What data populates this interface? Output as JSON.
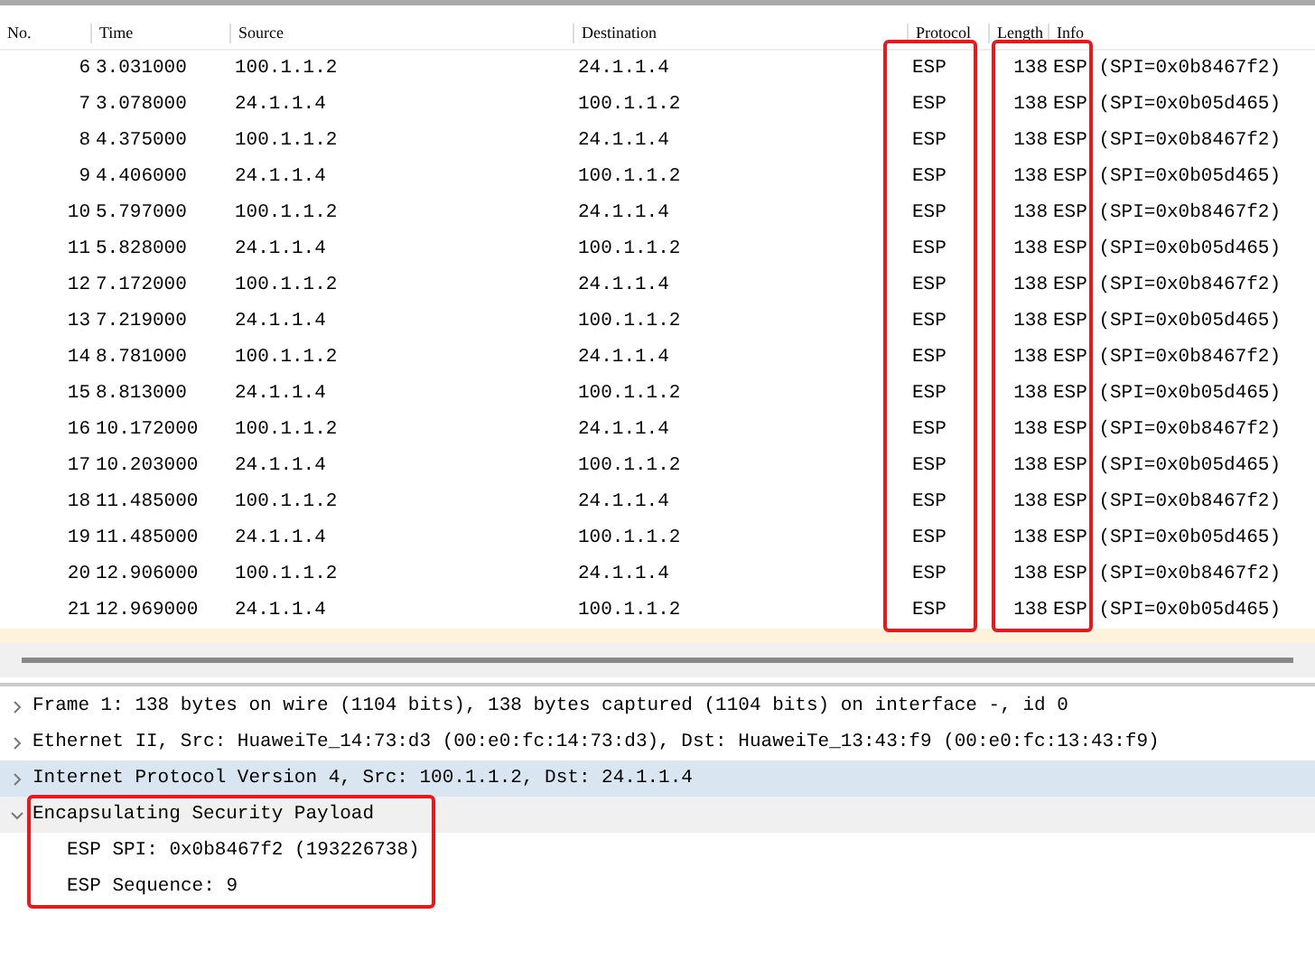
{
  "packet_list": {
    "columns": [
      "No.",
      "Time",
      "Source",
      "Destination",
      "Protocol",
      "Length",
      "Info"
    ],
    "rows": [
      [
        "6",
        "3.031000",
        "100.1.1.2",
        "24.1.1.4",
        "ESP",
        "138",
        "ESP (SPI=0x0b8467f2)"
      ],
      [
        "7",
        "3.078000",
        "24.1.1.4",
        "100.1.1.2",
        "ESP",
        "138",
        "ESP (SPI=0x0b05d465)"
      ],
      [
        "8",
        "4.375000",
        "100.1.1.2",
        "24.1.1.4",
        "ESP",
        "138",
        "ESP (SPI=0x0b8467f2)"
      ],
      [
        "9",
        "4.406000",
        "24.1.1.4",
        "100.1.1.2",
        "ESP",
        "138",
        "ESP (SPI=0x0b05d465)"
      ],
      [
        "10",
        "5.797000",
        "100.1.1.2",
        "24.1.1.4",
        "ESP",
        "138",
        "ESP (SPI=0x0b8467f2)"
      ],
      [
        "11",
        "5.828000",
        "24.1.1.4",
        "100.1.1.2",
        "ESP",
        "138",
        "ESP (SPI=0x0b05d465)"
      ],
      [
        "12",
        "7.172000",
        "100.1.1.2",
        "24.1.1.4",
        "ESP",
        "138",
        "ESP (SPI=0x0b8467f2)"
      ],
      [
        "13",
        "7.219000",
        "24.1.1.4",
        "100.1.1.2",
        "ESP",
        "138",
        "ESP (SPI=0x0b05d465)"
      ],
      [
        "14",
        "8.781000",
        "100.1.1.2",
        "24.1.1.4",
        "ESP",
        "138",
        "ESP (SPI=0x0b8467f2)"
      ],
      [
        "15",
        "8.813000",
        "24.1.1.4",
        "100.1.1.2",
        "ESP",
        "138",
        "ESP (SPI=0x0b05d465)"
      ],
      [
        "16",
        "10.172000",
        "100.1.1.2",
        "24.1.1.4",
        "ESP",
        "138",
        "ESP (SPI=0x0b8467f2)"
      ],
      [
        "17",
        "10.203000",
        "24.1.1.4",
        "100.1.1.2",
        "ESP",
        "138",
        "ESP (SPI=0x0b05d465)"
      ],
      [
        "18",
        "11.485000",
        "100.1.1.2",
        "24.1.1.4",
        "ESP",
        "138",
        "ESP (SPI=0x0b8467f2)"
      ],
      [
        "19",
        "11.485000",
        "24.1.1.4",
        "100.1.1.2",
        "ESP",
        "138",
        "ESP (SPI=0x0b05d465)"
      ],
      [
        "20",
        "12.906000",
        "100.1.1.2",
        "24.1.1.4",
        "ESP",
        "138",
        "ESP (SPI=0x0b8467f2)"
      ],
      [
        "21",
        "12.969000",
        "24.1.1.4",
        "100.1.1.2",
        "ESP",
        "138",
        "ESP (SPI=0x0b05d465)"
      ]
    ]
  },
  "packet_details": [
    {
      "label": "Frame 1: 138 bytes on wire (1104 bits), 138 bytes captured (1104 bits) on interface -, id 0",
      "expanded": false,
      "selected": false
    },
    {
      "label": "Ethernet II, Src: HuaweiTe_14:73:d3 (00:e0:fc:14:73:d3), Dst: HuaweiTe_13:43:f9 (00:e0:fc:13:43:f9)",
      "expanded": false,
      "selected": false
    },
    {
      "label": "Internet Protocol Version 4, Src: 100.1.1.2, Dst: 24.1.1.4",
      "expanded": false,
      "selected": true
    },
    {
      "label": "Encapsulating Security Payload",
      "expanded": true,
      "selected": false,
      "children": [
        {
          "label": "ESP SPI: 0x0b8467f2 (193226738)"
        },
        {
          "label": "ESP Sequence: 9"
        }
      ]
    }
  ],
  "annotations": [
    {
      "kind": "protocol-column"
    },
    {
      "kind": "length-info-column"
    },
    {
      "kind": "esp-section"
    }
  ]
}
